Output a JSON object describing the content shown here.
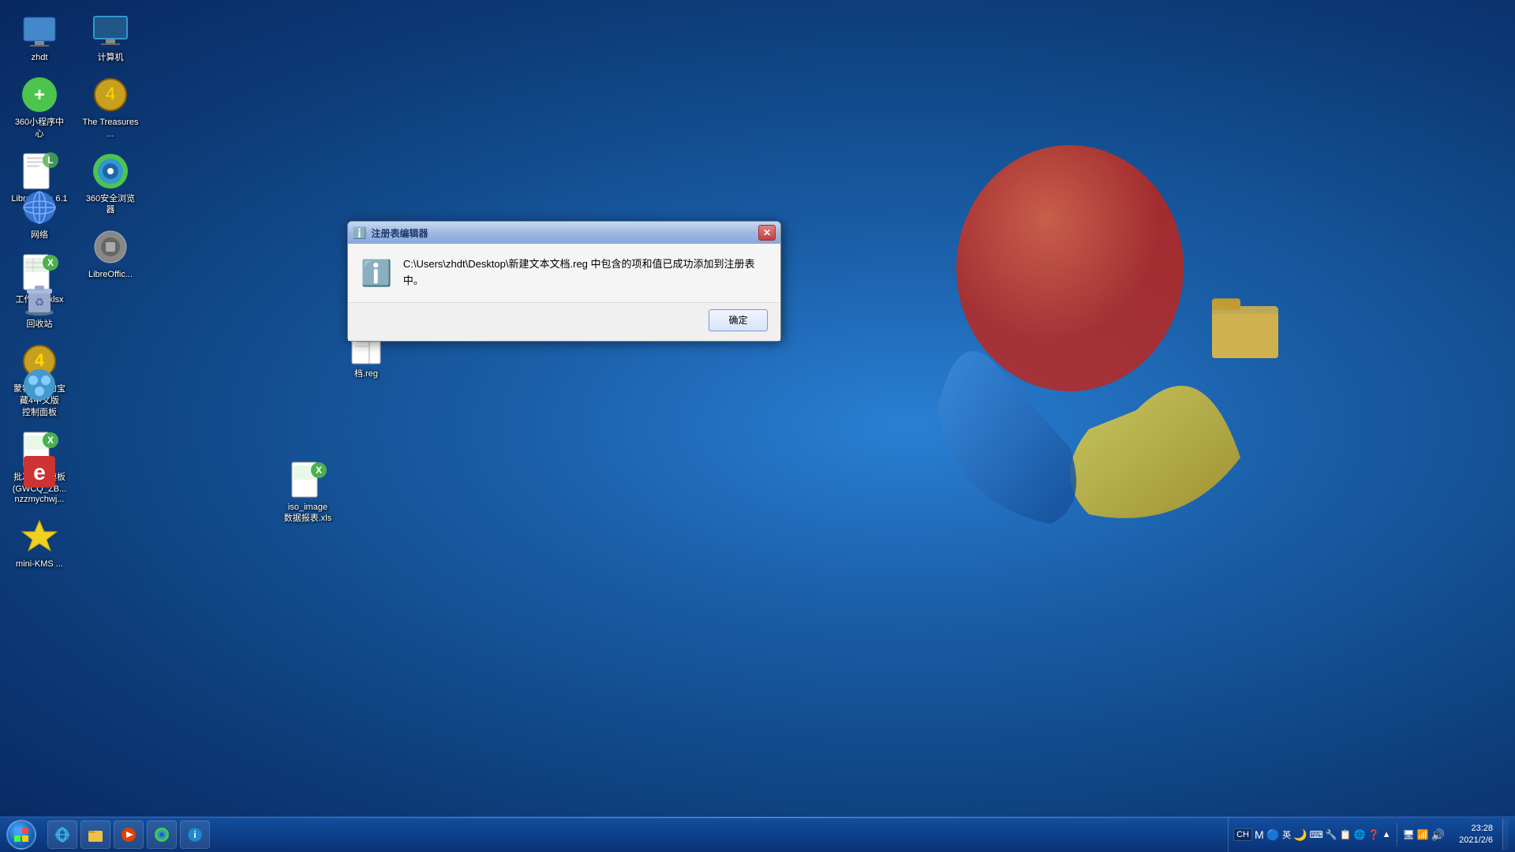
{
  "desktop": {
    "background_color": "#1560b0"
  },
  "icons": [
    {
      "id": "zhdt",
      "label": "zhdt",
      "emoji": "🖥️",
      "row": 0,
      "col": 0
    },
    {
      "id": "360app",
      "label": "360小程序中心",
      "emoji": "➕",
      "row": 1,
      "col": 0
    },
    {
      "id": "libreoffice61",
      "label": "LibreOffice 6.1",
      "emoji": "📄",
      "row": 2,
      "col": 0
    },
    {
      "id": "computer",
      "label": "计算机",
      "emoji": "🖥️",
      "row": 0,
      "col": 1
    },
    {
      "id": "treasures",
      "label": "The Treasures ...",
      "emoji": "🏆",
      "row": 1,
      "col": 1
    },
    {
      "id": "browser360",
      "label": "360安全浏览器",
      "emoji": "🌐",
      "row": 2,
      "col": 1
    },
    {
      "id": "libreoffice2",
      "label": "LibreOffic...",
      "emoji": "💿",
      "row": 3,
      "col": 1
    },
    {
      "id": "network",
      "label": "网络",
      "emoji": "🌐",
      "row": 0,
      "col": 2
    },
    {
      "id": "workbook1",
      "label": "工作簿1.xlsx",
      "emoji": "📊",
      "row": 1,
      "col": 2
    },
    {
      "id": "recycle",
      "label": "回收站",
      "emoji": "🗑️",
      "row": 0,
      "col": 3
    },
    {
      "id": "montezuma",
      "label": "蒙特祖玛的宝藏4中文版",
      "emoji": "🏆",
      "row": 1,
      "col": 3
    },
    {
      "id": "controlpanel",
      "label": "控制面板",
      "emoji": "🖥️",
      "row": 0,
      "col": 4
    },
    {
      "id": "import",
      "label": "批次导入模板(GWCQ_ZB...",
      "emoji": "📊",
      "row": 1,
      "col": 4
    },
    {
      "id": "nzzmychwj",
      "label": "nzzmychwj...",
      "emoji": "🔧",
      "row": 0,
      "col": 5
    },
    {
      "id": "minikms",
      "label": "mini-KMS ...",
      "emoji": "⭐",
      "row": 1,
      "col": 5
    },
    {
      "id": "isoxls",
      "label": "iso_image数据报表.xls",
      "emoji": "📊",
      "row": 2,
      "col": 5
    }
  ],
  "reg_file": {
    "label": "档.reg",
    "emoji": "📋"
  },
  "dialog": {
    "title": "注册表编辑器",
    "title_icon": "ℹ️",
    "message": "C:\\Users\\zhdt\\Desktop\\新建文本文档.reg 中包含的项和值已成功添加到注册表中。",
    "ok_button": "确定"
  },
  "taskbar": {
    "start_label": "⊞",
    "items": [
      {
        "id": "ie",
        "emoji": "🌐"
      },
      {
        "id": "explorer",
        "emoji": "📁"
      },
      {
        "id": "media",
        "emoji": "▶️"
      },
      {
        "id": "360browser",
        "emoji": "🛡️"
      },
      {
        "id": "360info",
        "emoji": "ℹ️"
      }
    ]
  },
  "clock": {
    "time": "23:28",
    "date": "2021/2/6"
  },
  "tray": {
    "lang": "CH",
    "icons": [
      "M",
      "🔵",
      "英",
      "🌙",
      "⌨️",
      "🔧",
      "📋",
      "🌐",
      "❓",
      "🔺",
      "▼",
      "🖥️",
      "📶",
      "🔊"
    ]
  }
}
